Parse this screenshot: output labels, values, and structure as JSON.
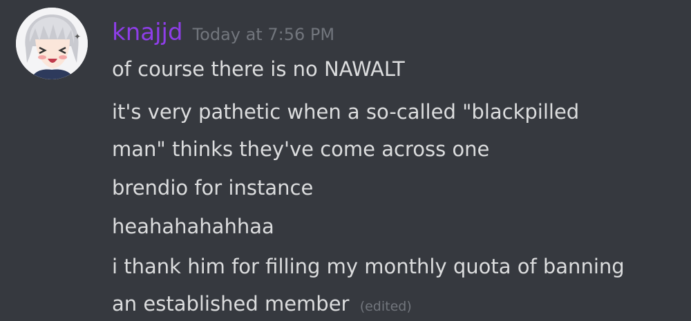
{
  "message": {
    "author": {
      "username": "knajjd",
      "name_color": "#8e3ee8",
      "avatar_icon": "anime-avatar-icon"
    },
    "timestamp": "Today at 7:56 PM",
    "lines": [
      "of course there is no NAWALT",
      "it's very pathetic when a so-called \"blackpilled",
      "man\" thinks they've come across one",
      "brendio for instance",
      "heahahahahhaa",
      "i thank him for filling my monthly quota of banning",
      "an established member"
    ],
    "edited_label": "(edited)"
  },
  "colors": {
    "background": "#36393f",
    "text": "#dcddde",
    "muted": "#72767d"
  }
}
